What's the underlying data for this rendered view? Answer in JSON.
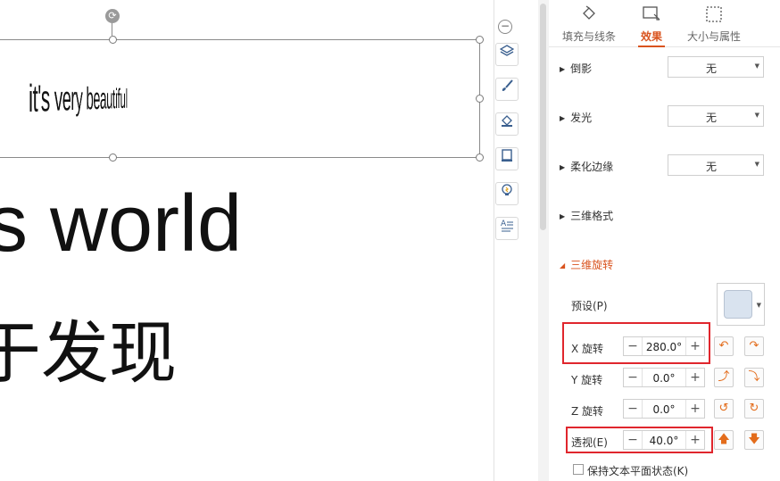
{
  "canvas": {
    "wordart_text": "it's very beautiful",
    "line_world": "s world",
    "line_chinese": "于发现"
  },
  "toolbar": {
    "collapse_symbol": "−",
    "buttons": [
      "layers-icon",
      "brush-icon",
      "fill-icon",
      "shape-outline-icon",
      "lightbulb-icon",
      "text-format-icon"
    ]
  },
  "tabs": [
    {
      "label": "填充与线条",
      "icon": "fill-bucket-icon"
    },
    {
      "label": "效果",
      "icon": "effects-icon"
    },
    {
      "label": "大小与属性",
      "icon": "size-icon"
    }
  ],
  "effects": {
    "shadow": {
      "label": "倒影",
      "value": "无"
    },
    "glow": {
      "label": "发光",
      "value": "无"
    },
    "soft_edges": {
      "label": "柔化边缘",
      "value": "无"
    },
    "format_3d": {
      "label": "三维格式"
    },
    "rotation_3d": {
      "label": "三维旋转",
      "preset_label": "预设(P)",
      "x": {
        "label": "X 旋转",
        "value": "280.0°"
      },
      "y": {
        "label": "Y 旋转",
        "value": "0.0°"
      },
      "z": {
        "label": "Z 旋转",
        "value": "0.0°"
      },
      "perspective": {
        "label": "透视(E)",
        "value": "40.0°"
      },
      "keep_flat_label": "保持文本平面状态(K)"
    }
  },
  "colors": {
    "accent": "#d9531e",
    "highlight_box": "#e0262d",
    "preset_swatch": "#d9e3ef"
  }
}
